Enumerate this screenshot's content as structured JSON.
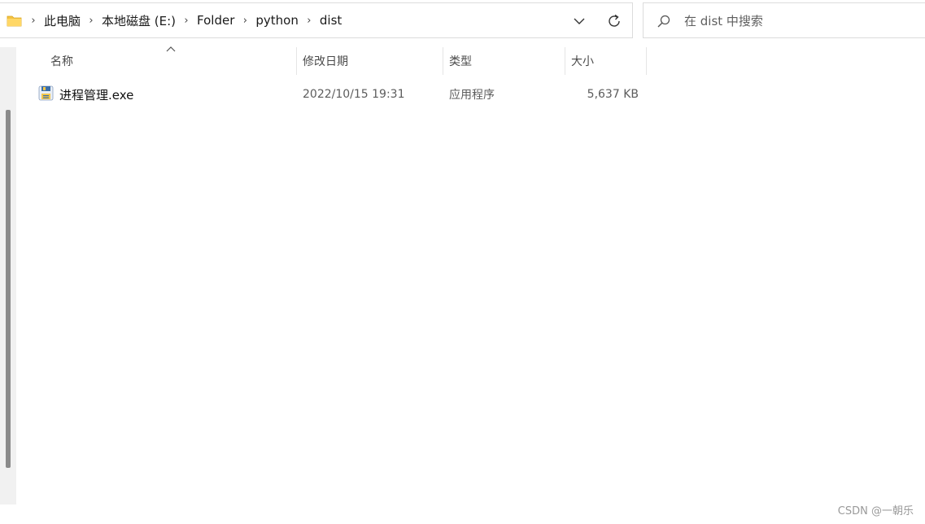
{
  "address": {
    "breadcrumbs": [
      "此电脑",
      "本地磁盘 (E:)",
      "Folder",
      "python",
      "dist"
    ],
    "folder_icon": "folder-icon",
    "dropdown_icon": "chevron-down-icon",
    "refresh_icon": "refresh-icon"
  },
  "search": {
    "placeholder": "在 dist 中搜索",
    "icon": "search-icon"
  },
  "columns": {
    "name": "名称",
    "date": "修改日期",
    "type": "类型",
    "size": "大小"
  },
  "files": [
    {
      "name": "进程管理.exe",
      "date": "2022/10/15 19:31",
      "type": "应用程序",
      "size": "5,637 KB",
      "icon": "python-exe-icon"
    }
  ],
  "watermark": "CSDN @一朝乐",
  "colors": {
    "folder": "#f5c342",
    "border": "#dcdcdc",
    "nav_bg": "#f1f1f1",
    "scrollbar": "#8a8a8a"
  }
}
